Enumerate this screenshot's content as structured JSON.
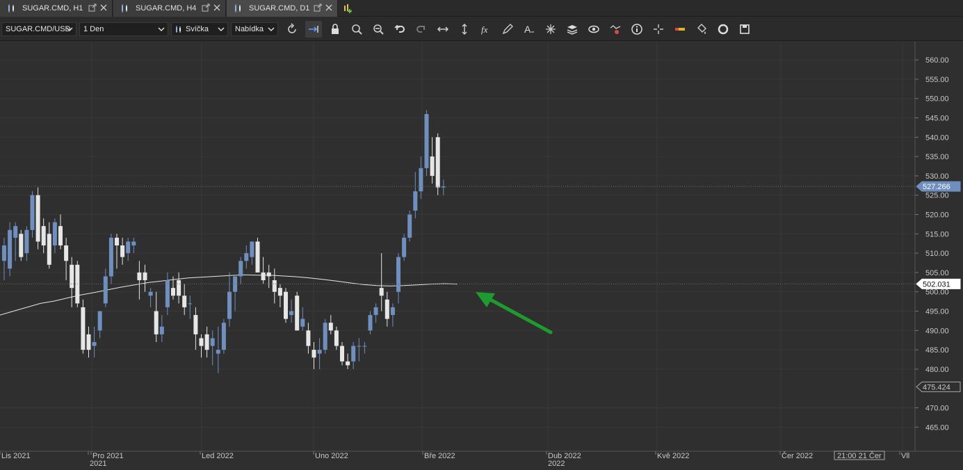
{
  "tabs": [
    {
      "label": "SUGAR.CMD, H1",
      "active": false
    },
    {
      "label": "SUGAR.CMD, H4",
      "active": false
    },
    {
      "label": "SUGAR.CMD, D1",
      "active": true
    }
  ],
  "toolbar": {
    "symbol": "SUGAR.CMD/USD",
    "timeframe": "1 Den",
    "chart_type": "Svíčka",
    "price_type": "Nabídka",
    "icons": [
      "refresh-icon",
      "scroll-to-end-icon",
      "lock-icon",
      "zoom-in-icon",
      "zoom-out-icon",
      "undo-icon",
      "redo-icon",
      "fit-horizontal-icon",
      "fit-vertical-icon",
      "indicator-fx-icon",
      "draw-pencil-icon",
      "text-tool-icon",
      "crosshair-star-icon",
      "layers-icon",
      "visibility-eye-icon",
      "alert-pattern-icon",
      "info-icon",
      "cursor-cross-icon",
      "ruler-icon",
      "paint-bucket-icon",
      "cycle-icon",
      "save-icon"
    ]
  },
  "colors": {
    "background": "#2f2f2f",
    "bull_candle": "#6f8fbf",
    "bear_candle": "#e6e6e6",
    "ma_line": "#e8e8e8",
    "arrow": "#1e9a2e",
    "axis_text": "#c8c8c8"
  },
  "axis": {
    "price_labels": [
      "560.00",
      "555.00",
      "550.00",
      "545.00",
      "540.00",
      "535.00",
      "530.00",
      "525.00",
      "520.00",
      "515.00",
      "510.00",
      "505.00",
      "500.00",
      "495.00",
      "490.00",
      "485.00",
      "480.00",
      "470.00",
      "465.00"
    ],
    "current_price": "527.266",
    "ma_value": "502.031",
    "low_marker": "475.424",
    "time_labels": [
      {
        "text": "Lis 2021"
      },
      {
        "text": "Pro 2021"
      },
      {
        "text": "2021"
      },
      {
        "text": "Led 2022"
      },
      {
        "text": "Uno 2022"
      },
      {
        "text": "Bře 2022"
      },
      {
        "text": "Dub 2022"
      },
      {
        "text": "2022"
      },
      {
        "text": "Kvě 2022"
      },
      {
        "text": "Čer 2022"
      },
      {
        "text": "Vll"
      }
    ],
    "time_cursor": "21:00 21 Čer"
  },
  "chart_data": {
    "type": "candlestick",
    "ylim": [
      462,
      562
    ],
    "candles": [
      {
        "o": 508,
        "h": 514,
        "l": 503,
        "c": 512
      },
      {
        "o": 506,
        "h": 518,
        "l": 504,
        "c": 516
      },
      {
        "o": 514,
        "h": 518,
        "l": 508,
        "c": 517
      },
      {
        "o": 515,
        "h": 516,
        "l": 508,
        "c": 509
      },
      {
        "o": 510,
        "h": 517,
        "l": 508,
        "c": 516
      },
      {
        "o": 516,
        "h": 526,
        "l": 514,
        "c": 525
      },
      {
        "o": 525,
        "h": 527,
        "l": 511,
        "c": 513
      },
      {
        "o": 517,
        "h": 519,
        "l": 510,
        "c": 512
      },
      {
        "o": 515,
        "h": 518,
        "l": 506,
        "c": 507
      },
      {
        "o": 512,
        "h": 519,
        "l": 510,
        "c": 518
      },
      {
        "o": 517,
        "h": 520,
        "l": 511,
        "c": 512
      },
      {
        "o": 512,
        "h": 514,
        "l": 503,
        "c": 508
      },
      {
        "o": 507,
        "h": 509,
        "l": 496,
        "c": 501
      },
      {
        "o": 507,
        "h": 508,
        "l": 496,
        "c": 497
      },
      {
        "o": 496,
        "h": 498,
        "l": 484,
        "c": 485
      },
      {
        "o": 489,
        "h": 491,
        "l": 483,
        "c": 485
      },
      {
        "o": 486,
        "h": 491,
        "l": 483,
        "c": 487
      },
      {
        "o": 490,
        "h": 495,
        "l": 488,
        "c": 495
      },
      {
        "o": 497,
        "h": 506,
        "l": 496,
        "c": 504
      },
      {
        "o": 504,
        "h": 515,
        "l": 502,
        "c": 514
      },
      {
        "o": 514,
        "h": 515,
        "l": 506,
        "c": 512
      },
      {
        "o": 512,
        "h": 514,
        "l": 507,
        "c": 509
      },
      {
        "o": 510,
        "h": 514,
        "l": 508,
        "c": 513
      },
      {
        "o": 512,
        "h": 514,
        "l": 510,
        "c": 513
      },
      {
        "o": 505,
        "h": 508,
        "l": 498,
        "c": 503
      },
      {
        "o": 505,
        "h": 507,
        "l": 500,
        "c": 503
      },
      {
        "o": 499,
        "h": 501,
        "l": 496,
        "c": 500
      },
      {
        "o": 495,
        "h": 500,
        "l": 487,
        "c": 489
      },
      {
        "o": 489,
        "h": 494,
        "l": 487,
        "c": 491
      },
      {
        "o": 496,
        "h": 505,
        "l": 494,
        "c": 503
      },
      {
        "o": 501,
        "h": 504,
        "l": 498,
        "c": 499
      },
      {
        "o": 503,
        "h": 505,
        "l": 497,
        "c": 499
      },
      {
        "o": 499,
        "h": 502,
        "l": 494,
        "c": 496
      },
      {
        "o": 497,
        "h": 499,
        "l": 493,
        "c": 497
      },
      {
        "o": 494,
        "h": 496,
        "l": 485,
        "c": 489
      },
      {
        "o": 488,
        "h": 489,
        "l": 483,
        "c": 486
      },
      {
        "o": 489,
        "h": 491,
        "l": 483,
        "c": 485
      },
      {
        "o": 486,
        "h": 490,
        "l": 481,
        "c": 488
      },
      {
        "o": 484,
        "h": 491,
        "l": 479,
        "c": 485
      },
      {
        "o": 485,
        "h": 493,
        "l": 484,
        "c": 492
      },
      {
        "o": 493,
        "h": 505,
        "l": 491,
        "c": 500
      },
      {
        "o": 500,
        "h": 504,
        "l": 495,
        "c": 504
      },
      {
        "o": 504,
        "h": 509,
        "l": 502,
        "c": 508
      },
      {
        "o": 508,
        "h": 512,
        "l": 506,
        "c": 510
      },
      {
        "o": 509,
        "h": 513,
        "l": 507,
        "c": 513
      },
      {
        "o": 513,
        "h": 514,
        "l": 505,
        "c": 505
      },
      {
        "o": 505,
        "h": 509,
        "l": 502,
        "c": 503
      },
      {
        "o": 505,
        "h": 507,
        "l": 501,
        "c": 504
      },
      {
        "o": 503,
        "h": 506,
        "l": 497,
        "c": 500
      },
      {
        "o": 501,
        "h": 502,
        "l": 496,
        "c": 499
      },
      {
        "o": 500,
        "h": 501,
        "l": 492,
        "c": 493
      },
      {
        "o": 494,
        "h": 498,
        "l": 492,
        "c": 495
      },
      {
        "o": 499,
        "h": 500,
        "l": 490,
        "c": 490
      },
      {
        "o": 491,
        "h": 496,
        "l": 490,
        "c": 493
      },
      {
        "o": 490,
        "h": 492,
        "l": 484,
        "c": 486
      },
      {
        "o": 485,
        "h": 487,
        "l": 480,
        "c": 483
      },
      {
        "o": 484,
        "h": 488,
        "l": 480,
        "c": 485
      },
      {
        "o": 485,
        "h": 493,
        "l": 484,
        "c": 492
      },
      {
        "o": 492,
        "h": 494,
        "l": 489,
        "c": 490
      },
      {
        "o": 490,
        "h": 491,
        "l": 485,
        "c": 486
      },
      {
        "o": 486,
        "h": 487,
        "l": 481,
        "c": 482
      },
      {
        "o": 482,
        "h": 484,
        "l": 480,
        "c": 481
      },
      {
        "o": 482,
        "h": 487,
        "l": 480,
        "c": 486
      },
      {
        "o": 486,
        "h": 488,
        "l": 482,
        "c": 486
      },
      {
        "o": 486,
        "h": 487,
        "l": 484,
        "c": 486
      },
      {
        "o": 490,
        "h": 495,
        "l": 489,
        "c": 494
      },
      {
        "o": 494,
        "h": 497,
        "l": 492,
        "c": 496
      },
      {
        "o": 501,
        "h": 510,
        "l": 495,
        "c": 499
      },
      {
        "o": 498,
        "h": 500,
        "l": 491,
        "c": 493
      },
      {
        "o": 494,
        "h": 497,
        "l": 491,
        "c": 496
      },
      {
        "o": 500,
        "h": 510,
        "l": 497,
        "c": 509
      },
      {
        "o": 509,
        "h": 515,
        "l": 508,
        "c": 514
      },
      {
        "o": 514,
        "h": 521,
        "l": 513,
        "c": 520
      },
      {
        "o": 521,
        "h": 531,
        "l": 519,
        "c": 526
      },
      {
        "o": 526,
        "h": 535,
        "l": 524,
        "c": 532
      },
      {
        "o": 532,
        "h": 547,
        "l": 530,
        "c": 546
      },
      {
        "o": 535,
        "h": 540,
        "l": 528,
        "c": 530
      },
      {
        "o": 540,
        "h": 541,
        "l": 525,
        "c": 527
      },
      {
        "o": 527,
        "h": 529,
        "l": 525,
        "c": 527.27
      }
    ],
    "moving_average": [
      494,
      495,
      496,
      497,
      497.6,
      498.4,
      499.2,
      499.8,
      500.5,
      501.2,
      501.8,
      502.4,
      502.8,
      503.2,
      503.6,
      503.8,
      504,
      504.2,
      504.4,
      504.3,
      504.3,
      504.1,
      503.9,
      503.6,
      503.2,
      502.8,
      502.3,
      501.9,
      501.6,
      501.5,
      501.6,
      501.8,
      502.0,
      502.1,
      502.0
    ]
  }
}
